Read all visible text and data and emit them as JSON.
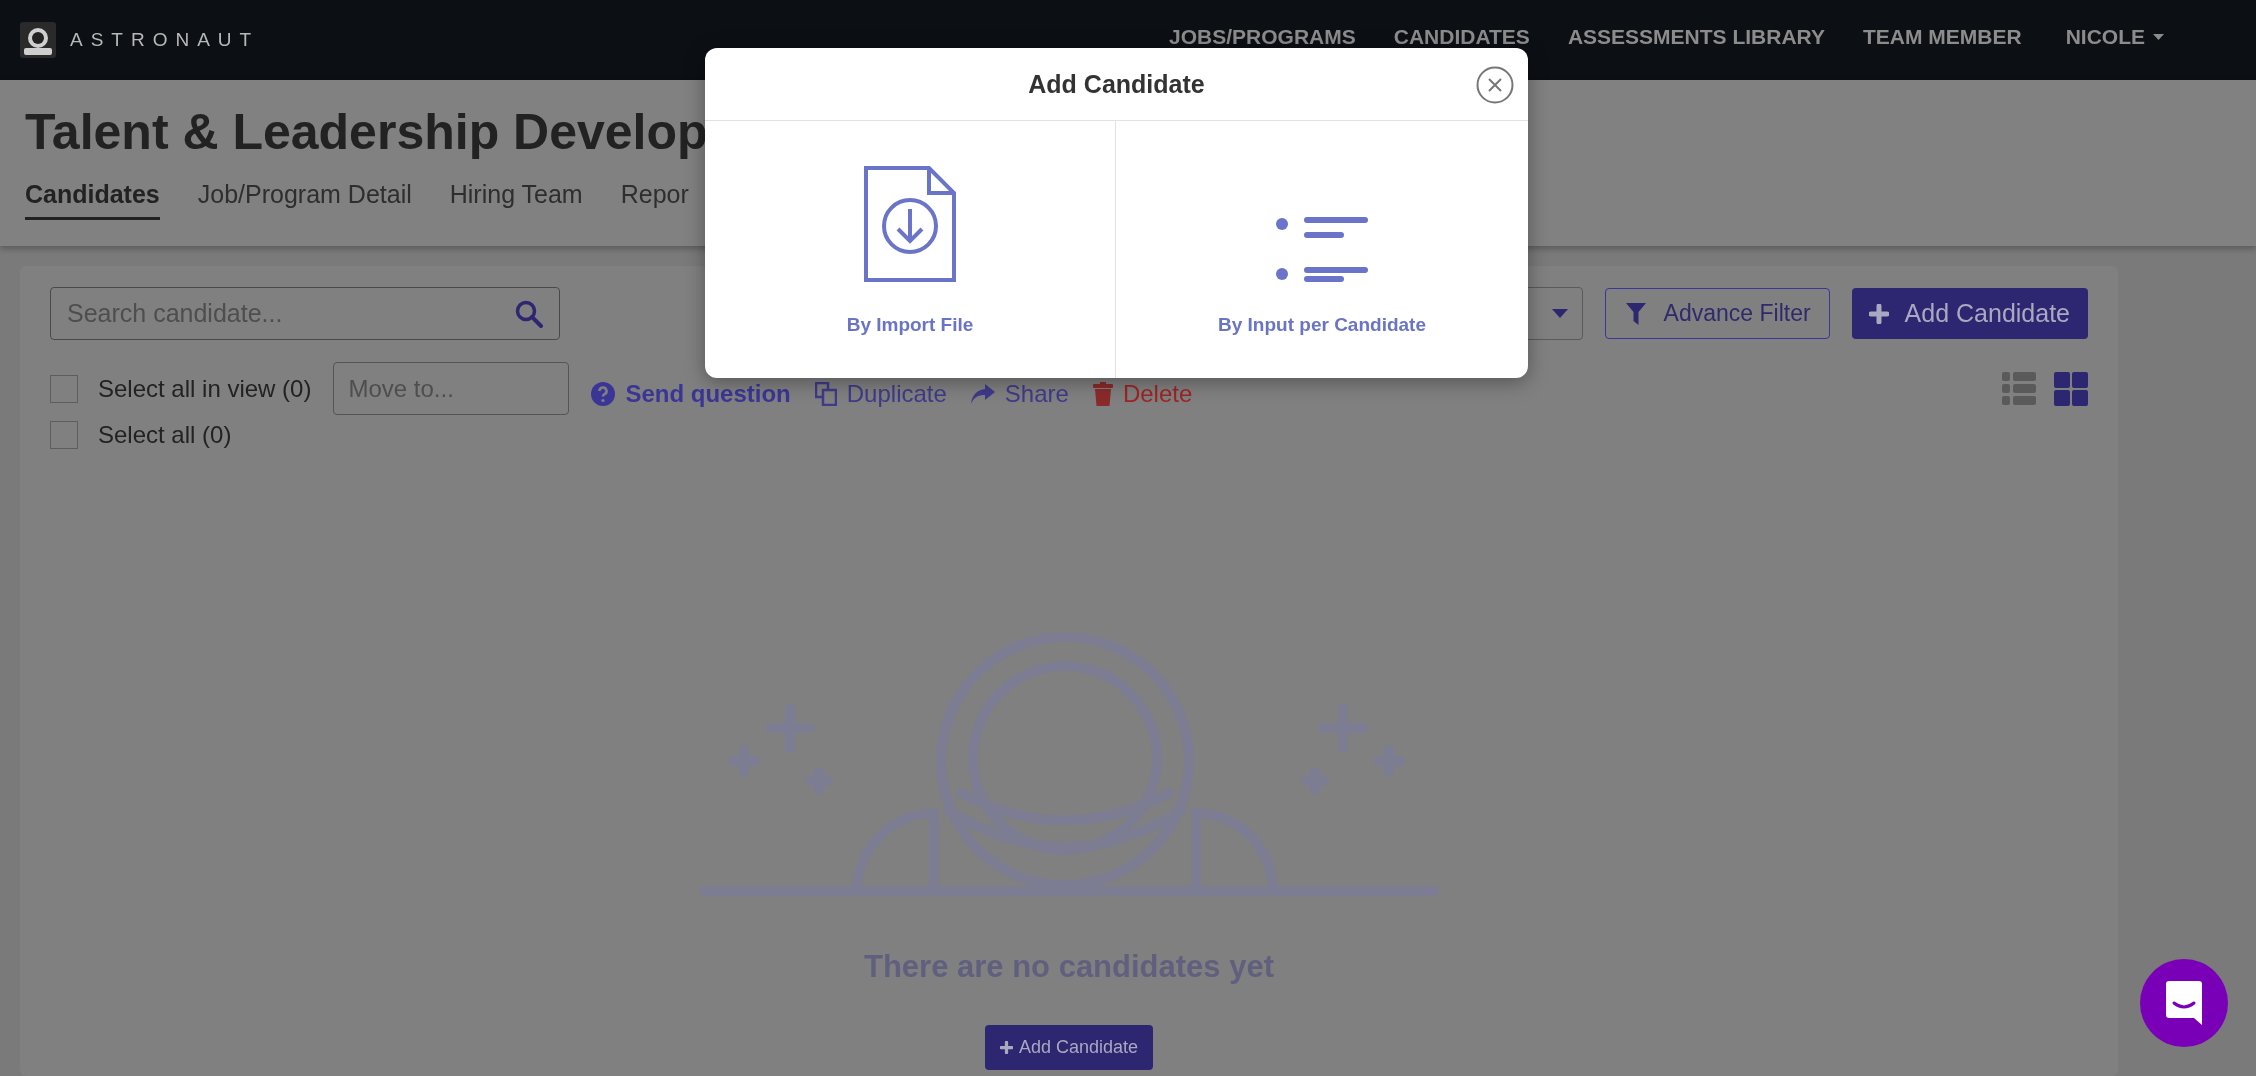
{
  "nav": {
    "logo": "ASTRONAUT",
    "links": [
      {
        "label": "JOBS/PROGRAMS"
      },
      {
        "label": "CANDIDATES"
      },
      {
        "label": "ASSESSMENTS LIBRARY"
      },
      {
        "label": "TEAM MEMBER"
      }
    ],
    "user": "NICOLE"
  },
  "page": {
    "title": "Talent & Leadership Develop",
    "tabs": [
      {
        "label": "Candidates",
        "selected": true
      },
      {
        "label": "Job/Program Detail",
        "selected": false
      },
      {
        "label": "Hiring Team",
        "selected": false
      },
      {
        "label": "Repor",
        "selected": false
      }
    ]
  },
  "toolbar": {
    "search": {
      "placeholder": "Search candidate..."
    },
    "advance_filter": "Advance Filter",
    "add_candidate": "Add Candidate",
    "select_all_in_view": {
      "label": "Select all in view (0)",
      "checked": false
    },
    "select_all": {
      "label": "Select all (0)",
      "checked": false
    },
    "move_to": {
      "placeholder": "Move to..."
    },
    "actions": [
      {
        "label": "Send question",
        "kind": "question"
      },
      {
        "label": "Duplicate",
        "kind": "duplicate"
      },
      {
        "label": "Share",
        "kind": "share"
      },
      {
        "label": "Delete",
        "kind": "delete"
      }
    ],
    "view_modes": [
      {
        "kind": "list",
        "selected": false
      },
      {
        "kind": "grid",
        "selected": true
      }
    ]
  },
  "empty_state": {
    "message": "There are no candidates yet",
    "button": "Add Candidate"
  },
  "modal": {
    "title": "Add Candidate",
    "options": [
      {
        "label": "By Import File",
        "kind": "import"
      },
      {
        "label": "By Input per Candidate",
        "kind": "input"
      }
    ]
  }
}
